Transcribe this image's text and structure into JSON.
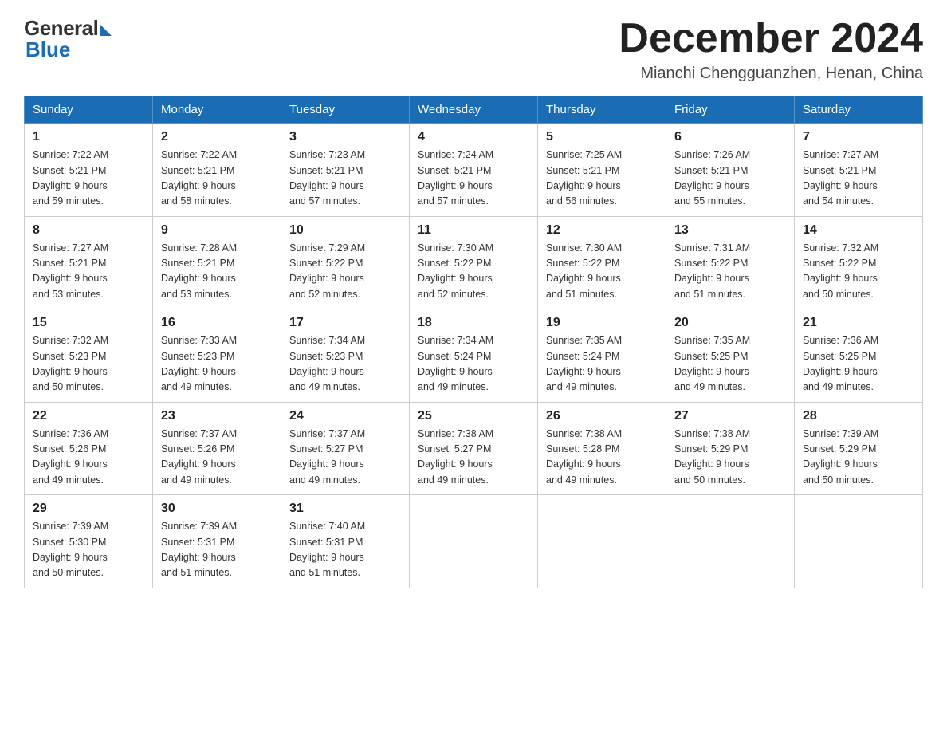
{
  "logo": {
    "general": "General",
    "blue": "Blue"
  },
  "title": "December 2024",
  "subtitle": "Mianchi Chengguanzhen, Henan, China",
  "days_of_week": [
    "Sunday",
    "Monday",
    "Tuesday",
    "Wednesday",
    "Thursday",
    "Friday",
    "Saturday"
  ],
  "weeks": [
    [
      {
        "day": "1",
        "sunrise": "7:22 AM",
        "sunset": "5:21 PM",
        "daylight": "9 hours and 59 minutes."
      },
      {
        "day": "2",
        "sunrise": "7:22 AM",
        "sunset": "5:21 PM",
        "daylight": "9 hours and 58 minutes."
      },
      {
        "day": "3",
        "sunrise": "7:23 AM",
        "sunset": "5:21 PM",
        "daylight": "9 hours and 57 minutes."
      },
      {
        "day": "4",
        "sunrise": "7:24 AM",
        "sunset": "5:21 PM",
        "daylight": "9 hours and 57 minutes."
      },
      {
        "day": "5",
        "sunrise": "7:25 AM",
        "sunset": "5:21 PM",
        "daylight": "9 hours and 56 minutes."
      },
      {
        "day": "6",
        "sunrise": "7:26 AM",
        "sunset": "5:21 PM",
        "daylight": "9 hours and 55 minutes."
      },
      {
        "day": "7",
        "sunrise": "7:27 AM",
        "sunset": "5:21 PM",
        "daylight": "9 hours and 54 minutes."
      }
    ],
    [
      {
        "day": "8",
        "sunrise": "7:27 AM",
        "sunset": "5:21 PM",
        "daylight": "9 hours and 53 minutes."
      },
      {
        "day": "9",
        "sunrise": "7:28 AM",
        "sunset": "5:21 PM",
        "daylight": "9 hours and 53 minutes."
      },
      {
        "day": "10",
        "sunrise": "7:29 AM",
        "sunset": "5:22 PM",
        "daylight": "9 hours and 52 minutes."
      },
      {
        "day": "11",
        "sunrise": "7:30 AM",
        "sunset": "5:22 PM",
        "daylight": "9 hours and 52 minutes."
      },
      {
        "day": "12",
        "sunrise": "7:30 AM",
        "sunset": "5:22 PM",
        "daylight": "9 hours and 51 minutes."
      },
      {
        "day": "13",
        "sunrise": "7:31 AM",
        "sunset": "5:22 PM",
        "daylight": "9 hours and 51 minutes."
      },
      {
        "day": "14",
        "sunrise": "7:32 AM",
        "sunset": "5:22 PM",
        "daylight": "9 hours and 50 minutes."
      }
    ],
    [
      {
        "day": "15",
        "sunrise": "7:32 AM",
        "sunset": "5:23 PM",
        "daylight": "9 hours and 50 minutes."
      },
      {
        "day": "16",
        "sunrise": "7:33 AM",
        "sunset": "5:23 PM",
        "daylight": "9 hours and 49 minutes."
      },
      {
        "day": "17",
        "sunrise": "7:34 AM",
        "sunset": "5:23 PM",
        "daylight": "9 hours and 49 minutes."
      },
      {
        "day": "18",
        "sunrise": "7:34 AM",
        "sunset": "5:24 PM",
        "daylight": "9 hours and 49 minutes."
      },
      {
        "day": "19",
        "sunrise": "7:35 AM",
        "sunset": "5:24 PM",
        "daylight": "9 hours and 49 minutes."
      },
      {
        "day": "20",
        "sunrise": "7:35 AM",
        "sunset": "5:25 PM",
        "daylight": "9 hours and 49 minutes."
      },
      {
        "day": "21",
        "sunrise": "7:36 AM",
        "sunset": "5:25 PM",
        "daylight": "9 hours and 49 minutes."
      }
    ],
    [
      {
        "day": "22",
        "sunrise": "7:36 AM",
        "sunset": "5:26 PM",
        "daylight": "9 hours and 49 minutes."
      },
      {
        "day": "23",
        "sunrise": "7:37 AM",
        "sunset": "5:26 PM",
        "daylight": "9 hours and 49 minutes."
      },
      {
        "day": "24",
        "sunrise": "7:37 AM",
        "sunset": "5:27 PM",
        "daylight": "9 hours and 49 minutes."
      },
      {
        "day": "25",
        "sunrise": "7:38 AM",
        "sunset": "5:27 PM",
        "daylight": "9 hours and 49 minutes."
      },
      {
        "day": "26",
        "sunrise": "7:38 AM",
        "sunset": "5:28 PM",
        "daylight": "9 hours and 49 minutes."
      },
      {
        "day": "27",
        "sunrise": "7:38 AM",
        "sunset": "5:29 PM",
        "daylight": "9 hours and 50 minutes."
      },
      {
        "day": "28",
        "sunrise": "7:39 AM",
        "sunset": "5:29 PM",
        "daylight": "9 hours and 50 minutes."
      }
    ],
    [
      {
        "day": "29",
        "sunrise": "7:39 AM",
        "sunset": "5:30 PM",
        "daylight": "9 hours and 50 minutes."
      },
      {
        "day": "30",
        "sunrise": "7:39 AM",
        "sunset": "5:31 PM",
        "daylight": "9 hours and 51 minutes."
      },
      {
        "day": "31",
        "sunrise": "7:40 AM",
        "sunset": "5:31 PM",
        "daylight": "9 hours and 51 minutes."
      },
      null,
      null,
      null,
      null
    ]
  ]
}
